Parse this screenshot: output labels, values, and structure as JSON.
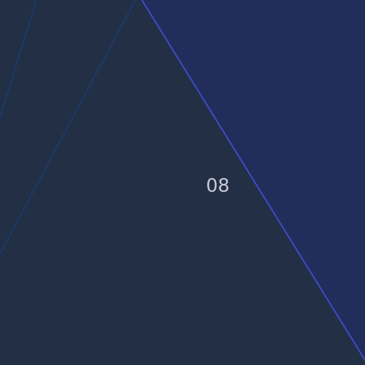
{
  "label": {
    "text": "08"
  },
  "colors": {
    "background": "#232f45",
    "right_panel": "#222d5c",
    "diagonal_edge": "#3e4cc8",
    "faint_lines": "#1c3a6a",
    "label_text": "#c7cad7"
  }
}
